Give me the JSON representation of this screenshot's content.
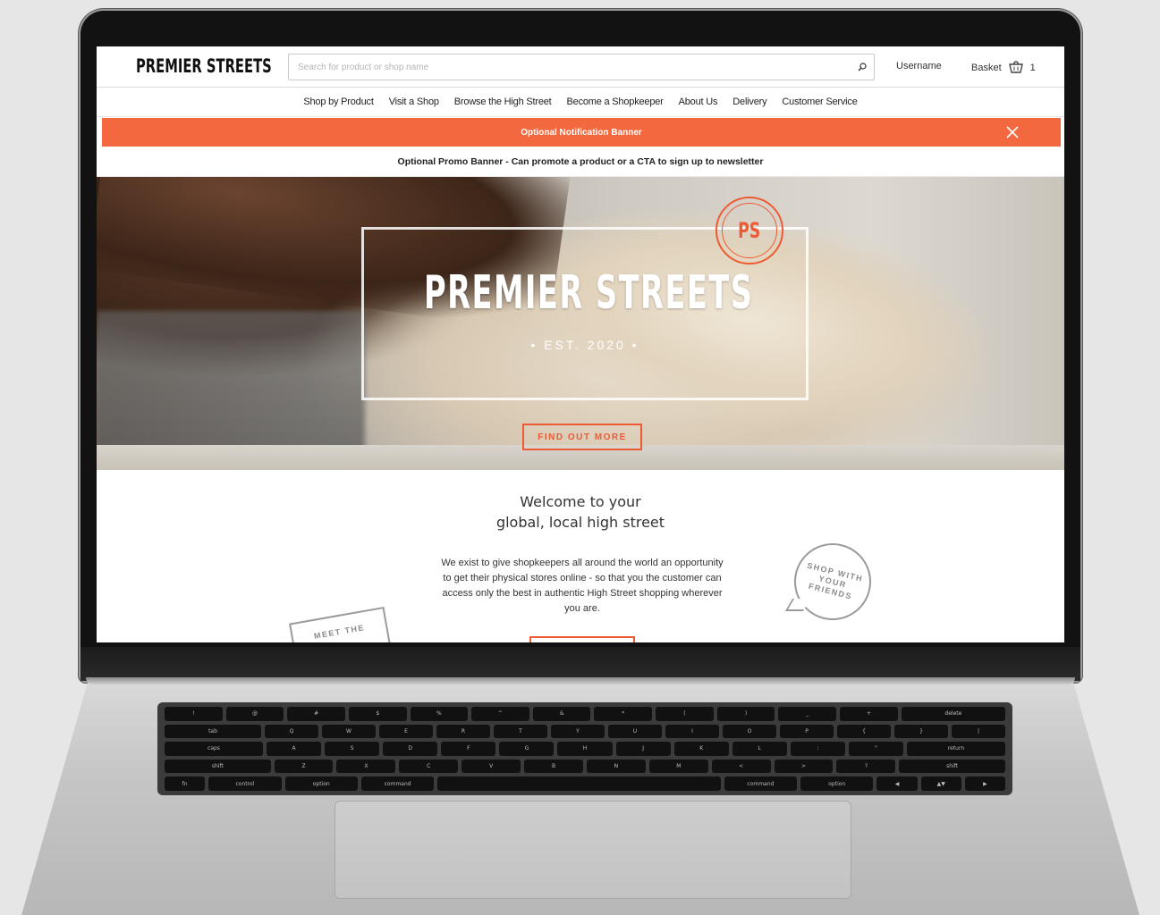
{
  "header": {
    "logo": "PREMIER STREETS",
    "search_placeholder": "Search for product or shop name",
    "username": "Username",
    "basket_label": "Basket",
    "basket_count": "1"
  },
  "nav": {
    "items": [
      "Shop by Product",
      "Visit a Shop",
      "Browse the High Street",
      "Become a Shopkeeper",
      "About Us",
      "Delivery",
      "Customer Service"
    ]
  },
  "notification": {
    "text": "Optional Notification Banner",
    "color": "#f4683f"
  },
  "promo": {
    "text": "Optional Promo Banner - Can promote a product or a CTA to sign up to newsletter"
  },
  "hero": {
    "badge": "PS",
    "title": "PREMIER STREETS",
    "established": "• EST. 2020 •",
    "cta_label": "FIND OUT MORE",
    "accent": "#ee5a33"
  },
  "welcome": {
    "line1": "Welcome to your",
    "line2": "global, local high street",
    "body": "We exist to give shopkeepers all around the world an opportunity to get their physical stores online - so that you the customer can access only the best in authentic High Street shopping wherever you are.",
    "bubble_text": "SHOP WITH YOUR FRIENDS",
    "card_text": "MEET THE"
  },
  "keyboard": {
    "row1": [
      "!",
      "@",
      "#",
      "$",
      "%",
      "^",
      "&",
      "*",
      "(",
      ")",
      "_",
      "+",
      "delete"
    ],
    "row2": [
      "tab",
      "Q",
      "W",
      "E",
      "R",
      "T",
      "Y",
      "U",
      "I",
      "O",
      "P",
      "{",
      "}",
      "|"
    ],
    "row3": [
      "caps",
      "A",
      "S",
      "D",
      "F",
      "G",
      "H",
      "J",
      "K",
      "L",
      ":",
      "\"",
      "return"
    ],
    "row4": [
      "shift",
      "Z",
      "X",
      "C",
      "V",
      "B",
      "N",
      "M",
      "<",
      ">",
      "?",
      "shift"
    ],
    "row5": [
      "fn",
      "control",
      "option",
      "command",
      "",
      "command",
      "option",
      "◀",
      "▲▼",
      "▶"
    ]
  }
}
